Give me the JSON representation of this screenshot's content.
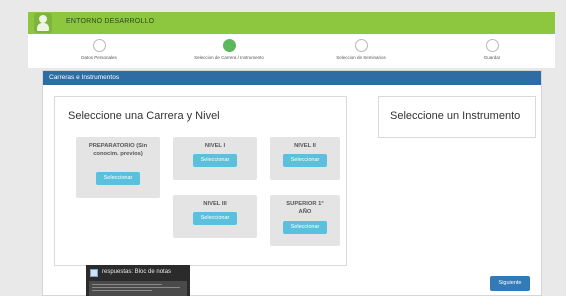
{
  "app": {
    "brand": "ENTORNO DESARROLLO"
  },
  "steps": [
    {
      "label": "Datos Personales",
      "active": false
    },
    {
      "label": "Seleccion de Carrera / Instrumento",
      "active": true
    },
    {
      "label": "Seleccion de Seminarios",
      "active": false
    },
    {
      "label": "Guardar",
      "active": false
    }
  ],
  "panel": {
    "header": "Carreras e Instrumentos"
  },
  "career": {
    "title": "Seleccione una Carrera y Nivel",
    "select_label": "Seleccionar",
    "cards": [
      {
        "title": "PREPARATORIO (Sin conocim. previos)"
      },
      {
        "title": "NIVEL I"
      },
      {
        "title": "NIVEL II"
      },
      {
        "title": "NIVEL III"
      },
      {
        "title": "SUPERIOR 1° AÑO"
      }
    ]
  },
  "instrument": {
    "title": "Seleccione un Instrumento"
  },
  "footer": {
    "next_label": "Siguiente"
  },
  "notepad": {
    "title": "respuestas: Bloc de notas"
  }
}
